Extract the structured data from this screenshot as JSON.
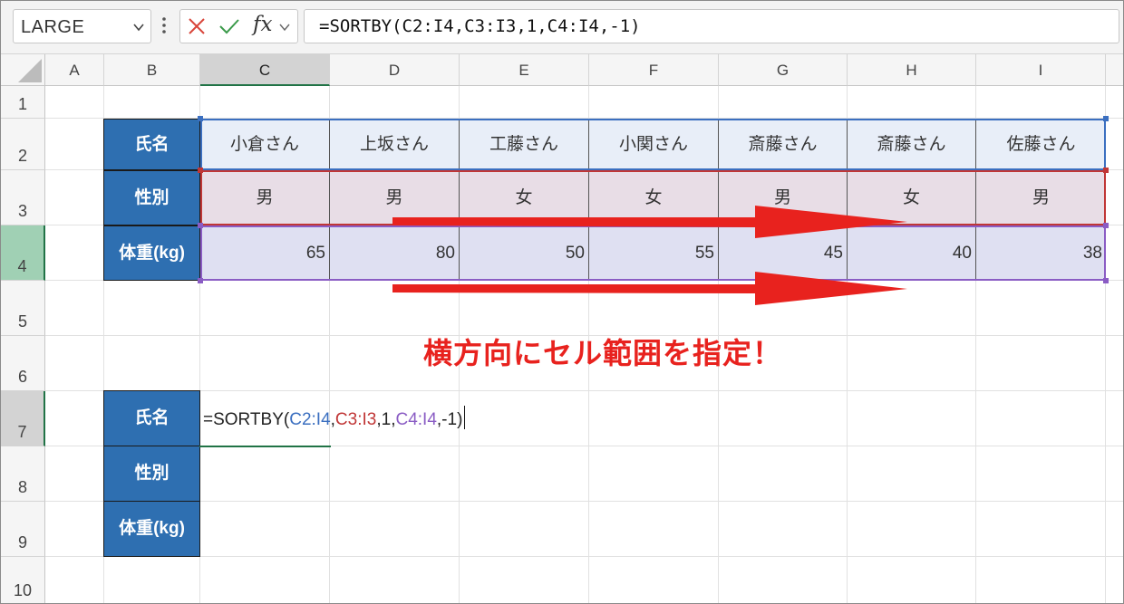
{
  "formula_bar": {
    "name_box": "LARGE",
    "fx_label": "fx",
    "formula": "=SORTBY(C2:I4,C3:I3,1,C4:I4,-1)"
  },
  "columns": [
    "A",
    "B",
    "C",
    "D",
    "E",
    "F",
    "G",
    "H",
    "I"
  ],
  "selected_column": "C",
  "rows": [
    "1",
    "2",
    "3",
    "4",
    "5",
    "6",
    "7",
    "8",
    "9",
    "10"
  ],
  "table": {
    "header_name": "氏名",
    "header_gender": "性別",
    "header_weight": "体重(kg)",
    "names": [
      "小倉さん",
      "上坂さん",
      "工藤さん",
      "小関さん",
      "斎藤さん",
      "斎藤さん",
      "佐藤さん"
    ],
    "genders": [
      "男",
      "男",
      "女",
      "女",
      "男",
      "女",
      "男"
    ],
    "weights": [
      65,
      80,
      50,
      55,
      45,
      40,
      38
    ]
  },
  "output_headers": {
    "name": "氏名",
    "gender": "性別",
    "weight": "体重(kg)"
  },
  "cell_edit": {
    "prefix": "=SORTBY(",
    "arg1": "C2:I4",
    "comma1": ",",
    "arg2": "C3:I3",
    "middle": ",1,",
    "arg3": "C4:I4",
    "suffix": ",-1)"
  },
  "annotation": "横方向にセル範囲を指定！",
  "colors": {
    "header_fill": "#2e6fb1",
    "range1": "#3b6fc0",
    "range2": "#c03636",
    "range3": "#8a5cc4",
    "arrow": "#e8221e",
    "excel_green": "#217346"
  }
}
